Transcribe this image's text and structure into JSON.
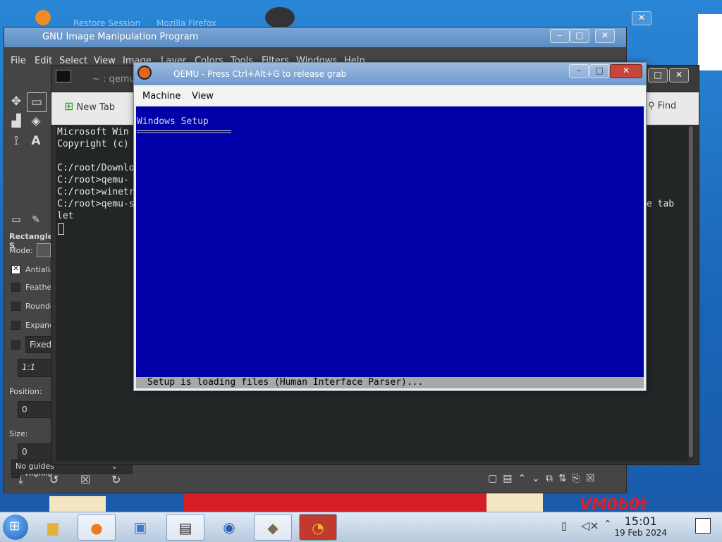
{
  "desktop": {
    "watermark": "VM0b0t",
    "faded_titles": [
      "Restore Session",
      "Mozilla Firefox"
    ]
  },
  "gimp": {
    "title": "GNU Image Manipulation Program",
    "menus": [
      "File",
      "Edit",
      "Select",
      "View",
      "Image",
      "Layer",
      "Colors",
      "Tools",
      "Filters",
      "Windows",
      "Help"
    ],
    "tool_options": {
      "title": "Rectangle S",
      "mode_label": "Mode:",
      "antialias": "Antialia",
      "feather": "Feathe",
      "rounded": "Rounde",
      "expand": "Expand",
      "fixed": "Fixed",
      "ratio": "1:1",
      "position_label": "Position:",
      "position_value": "0",
      "size_label": "Size:",
      "size_value": "0",
      "highlight": "Highlig",
      "guides": "No guides"
    }
  },
  "konsole": {
    "title": "~ : qemu-system-i38 — Konsole",
    "new_tab": "New Tab",
    "find": "Find",
    "lines": [
      "Microsoft Win",
      "Copyright (c)",
      "",
      "C:/root/Downlo",
      "C:/root>qemu-",
      "C:/root>winetr",
      "C:/root>qemu-s",
      "let"
    ],
    "right_fragment": "e tab"
  },
  "qemu": {
    "title": "QEMU - Press Ctrl+Alt+G to release grab",
    "menus": [
      "Machine",
      "View"
    ],
    "screen_title": "Windows Setup",
    "status": "Setup is loading files (Human Interface Parser)..."
  },
  "taskbar": {
    "time": "15:01",
    "date": "19 Feb 2024"
  }
}
